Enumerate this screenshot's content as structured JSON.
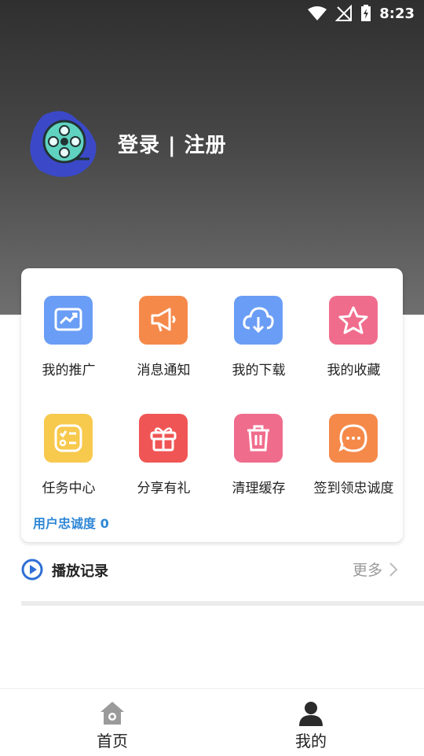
{
  "status_bar": {
    "time": "8:23"
  },
  "profile": {
    "login_label": "登录 | 注册"
  },
  "menu": {
    "items": [
      {
        "label": "我的推广",
        "icon": "chart-trend-icon",
        "color": "#6a9df5"
      },
      {
        "label": "消息通知",
        "icon": "megaphone-icon",
        "color": "#f5894a"
      },
      {
        "label": "我的下载",
        "icon": "cloud-download-icon",
        "color": "#6a9df5"
      },
      {
        "label": "我的收藏",
        "icon": "star-icon",
        "color": "#f06c8c"
      },
      {
        "label": "任务中心",
        "icon": "task-list-icon",
        "color": "#f7c94d"
      },
      {
        "label": "分享有礼",
        "icon": "gift-icon",
        "color": "#f05555"
      },
      {
        "label": "清理缓存",
        "icon": "trash-icon",
        "color": "#f06c8c"
      },
      {
        "label": "签到领忠诚度",
        "icon": "chat-dots-icon",
        "color": "#f5894a"
      }
    ],
    "loyalty_label": "用户忠诚度 0"
  },
  "history": {
    "title": "播放记录",
    "more_label": "更多"
  },
  "bottom_nav": {
    "tabs": [
      {
        "label": "首页"
      },
      {
        "label": "我的"
      }
    ]
  },
  "colors": {
    "accent": "#2f87d6",
    "header_dark": "#2f2f2f",
    "header_light": "#6f6f6f"
  }
}
